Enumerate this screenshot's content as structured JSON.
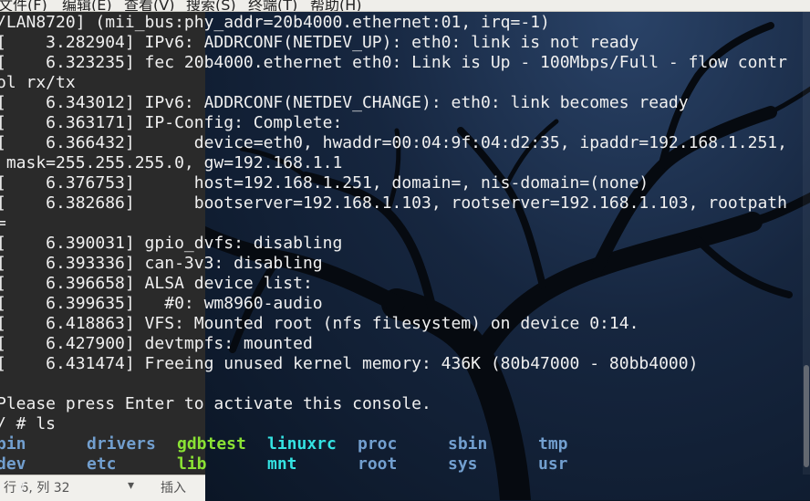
{
  "menubar": {
    "items": [
      "文件(F)",
      "编辑(E)",
      "查看(V)",
      "搜索(S)",
      "终端(T)",
      "帮助(H)"
    ]
  },
  "terminal": {
    "lines": [
      "/LAN8720] (mii_bus:phy_addr=20b4000.ethernet:01, irq=-1)",
      "[    3.282904] IPv6: ADDRCONF(NETDEV_UP): eth0: link is not ready",
      "[    6.323235] fec 20b4000.ethernet eth0: Link is Up - 100Mbps/Full - flow contr",
      "ol rx/tx",
      "[    6.343012] IPv6: ADDRCONF(NETDEV_CHANGE): eth0: link becomes ready",
      "[    6.363171] IP-Config: Complete:",
      "[    6.366432]      device=eth0, hwaddr=00:04:9f:04:d2:35, ipaddr=192.168.1.251,",
      " mask=255.255.255.0, gw=192.168.1.1",
      "[    6.376753]      host=192.168.1.251, domain=, nis-domain=(none)",
      "[    6.382686]      bootserver=192.168.1.103, rootserver=192.168.1.103, rootpath",
      "=",
      "[    6.390031] gpio_dvfs: disabling",
      "[    6.393336] can-3v3: disabling",
      "[    6.396658] ALSA device list:",
      "[    6.399635]   #0: wm8960-audio",
      "[    6.418863] VFS: Mounted root (nfs filesystem) on device 0:14.",
      "[    6.427900] devtmpfs: mounted",
      "[    6.431474] Freeing unused kernel memory: 436K (80b47000 - 80bb4000)",
      "",
      "Please press Enter to activate this console.",
      "/ # ls"
    ],
    "ls_rows": [
      [
        "bin",
        "drivers",
        "gdbtest",
        "linuxrc",
        "proc",
        "sbin",
        "tmp"
      ],
      [
        "dev",
        "etc",
        "lib",
        "mnt",
        "root",
        "sys",
        "usr"
      ]
    ],
    "ls_colors": [
      "#729fcf",
      "#729fcf",
      "#8ae234",
      "#34e2e2",
      "#729fcf",
      "#729fcf",
      "#729fcf"
    ],
    "prompt": "/ #"
  },
  "statusbar": {
    "position": "行 6, 列 32",
    "mode": "插入"
  },
  "colors": {
    "text": "#f0f0f0",
    "dir": "#729fcf",
    "exec": "#8ae234",
    "link": "#34e2e2",
    "background": "#0b1626"
  }
}
